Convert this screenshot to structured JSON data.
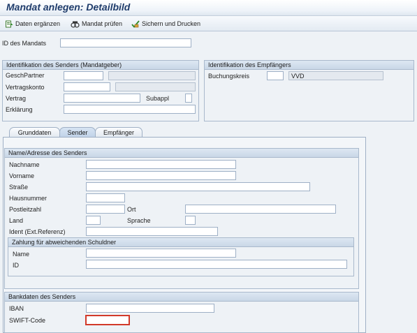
{
  "title": "Mandat anlegen: Detailbild",
  "toolbar": {
    "complete_label": "Daten ergänzen",
    "check_label": "Mandat prüfen",
    "save_print_label": "Sichern und Drucken"
  },
  "mandate_id": {
    "label": "ID des Mandats",
    "value": ""
  },
  "sender_ident": {
    "heading": "Identifikation des Senders (Mandatgeber)",
    "partner_label": "GeschPartner",
    "account_label": "Vertragskonto",
    "contract_label": "Vertrag",
    "subappl_label": "Subappl",
    "declaration_label": "Erklärung"
  },
  "recipient_ident": {
    "heading": "Identifikation des Empfängers",
    "company_label": "Buchungskreis",
    "company_code": "",
    "company_name": "VVD"
  },
  "tabs": [
    {
      "label": "Grunddaten"
    },
    {
      "label": "Sender"
    },
    {
      "label": "Empfänger"
    }
  ],
  "address": {
    "heading": "Name/Adresse des Senders",
    "lastname_label": "Nachname",
    "firstname_label": "Vorname",
    "street_label": "Straße",
    "housenumber_label": "Hausnummer",
    "postcode_label": "Postleitzahl",
    "city_label": "Ort",
    "country_label": "Land",
    "language_label": "Sprache",
    "ident_label": "Ident (Ext.Referenz)"
  },
  "debtor": {
    "heading": "Zahlung für abweichenden Schuldner",
    "name_label": "Name",
    "id_label": "ID"
  },
  "bank": {
    "heading": "Bankdaten des Senders",
    "iban_label": "IBAN",
    "swift_label": "SWIFT-Code"
  },
  "colors": {
    "title": "#1f3c6b",
    "accent": "#c9d7e7",
    "error_border": "#d23a2a"
  }
}
